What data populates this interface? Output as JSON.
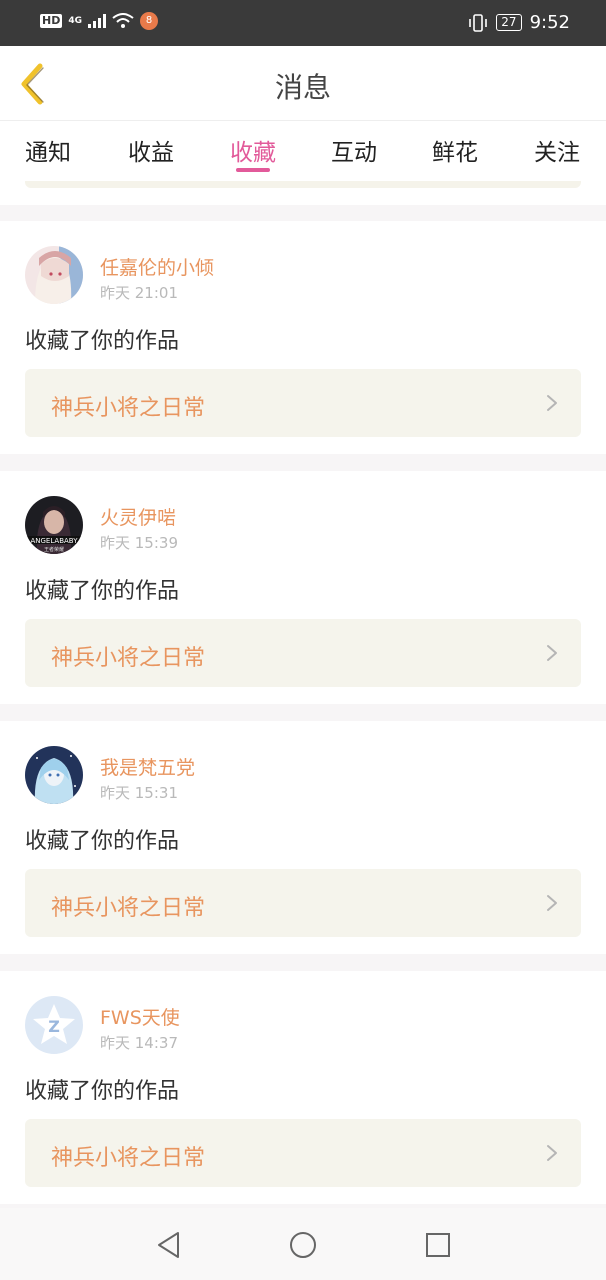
{
  "status_bar": {
    "hd": "HD",
    "network": "4G",
    "notification_badge": "8",
    "battery": "27",
    "time": "9:52"
  },
  "header": {
    "title": "消息",
    "back_icon": "chevron-left-icon"
  },
  "tabs": [
    {
      "label": "通知",
      "active": false
    },
    {
      "label": "收益",
      "active": false
    },
    {
      "label": "收藏",
      "active": true
    },
    {
      "label": "互动",
      "active": false
    },
    {
      "label": "鲜花",
      "active": false
    },
    {
      "label": "关注",
      "active": false
    }
  ],
  "notifications": [
    {
      "user": "任嘉伦的小倾",
      "time": "昨天 21:01",
      "action": "收藏了你的作品",
      "work": "神兵小将之日常"
    },
    {
      "user": "火灵伊啱",
      "time": "昨天 15:39",
      "action": "收藏了你的作品",
      "work": "神兵小将之日常"
    },
    {
      "user": "我是梵五党",
      "time": "昨天 15:31",
      "action": "收藏了你的作品",
      "work": "神兵小将之日常"
    },
    {
      "user": "FWS天使",
      "time": "昨天 14:37",
      "action": "收藏了你的作品",
      "work": "神兵小将之日常"
    }
  ],
  "colors": {
    "accent_pink": "#e25a9a",
    "username_orange": "#e8955f",
    "back_arrow_yellow": "#f0c22c",
    "work_box_bg": "#f5f4ec"
  }
}
